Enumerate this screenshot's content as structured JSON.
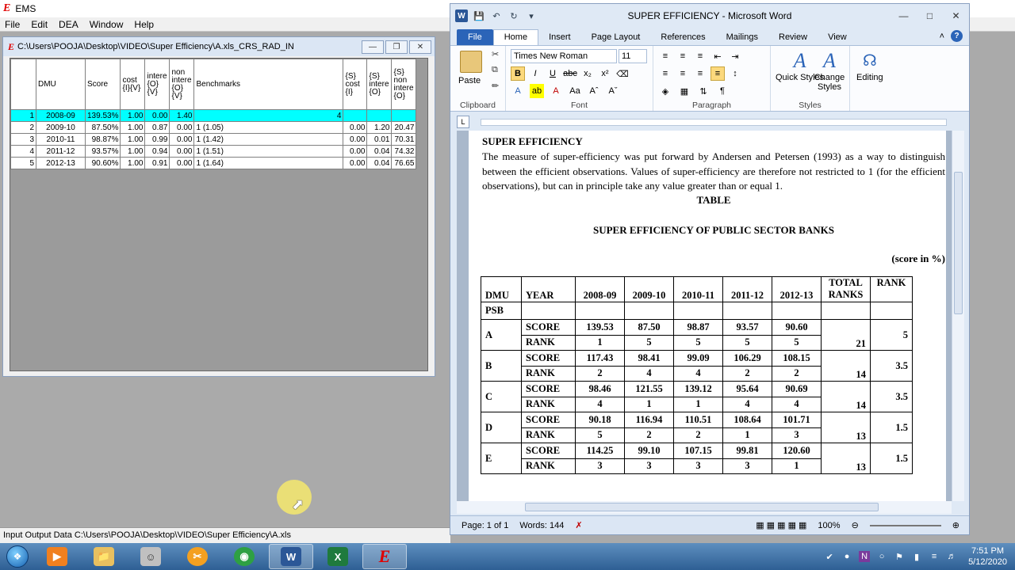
{
  "ems": {
    "title": "EMS",
    "logo": "E",
    "menu": [
      "File",
      "Edit",
      "DEA",
      "Window",
      "Help"
    ],
    "child_title": "C:\\Users\\POOJA\\Desktop\\VIDEO\\Super Efficiency\\A.xls_CRS_RAD_IN",
    "status": "Input Output Data C:\\Users\\POOJA\\Desktop\\VIDEO\\Super Efficiency\\A.xls",
    "grid": {
      "headers": [
        "DMU",
        "Score",
        "cost {I}{V}",
        "intere {O}{V}",
        "non intere {O}{V}",
        "Benchmarks",
        "{S} cost {I}",
        "{S} intere {O}",
        "{S} non intere {O}"
      ],
      "rows": [
        {
          "n": "1",
          "dmu": "2008-09",
          "score": "139.53%",
          "cost": "1.00",
          "intere": "0.00",
          "nonint": "1.40",
          "bench": "4",
          "s1": "",
          "s2": "",
          "s3": ""
        },
        {
          "n": "2",
          "dmu": "2009-10",
          "score": "87.50%",
          "cost": "1.00",
          "intere": "0.87",
          "nonint": "0.00",
          "bench": "1 (1.05)",
          "s1": "0.00",
          "s2": "1.20",
          "s3": "20.47"
        },
        {
          "n": "3",
          "dmu": "2010-11",
          "score": "98.87%",
          "cost": "1.00",
          "intere": "0.99",
          "nonint": "0.00",
          "bench": "1 (1.42)",
          "s1": "0.00",
          "s2": "0.01",
          "s3": "70.31"
        },
        {
          "n": "4",
          "dmu": "2011-12",
          "score": "93.57%",
          "cost": "1.00",
          "intere": "0.94",
          "nonint": "0.00",
          "bench": "1 (1.51)",
          "s1": "0.00",
          "s2": "0.04",
          "s3": "74.32"
        },
        {
          "n": "5",
          "dmu": "2012-13",
          "score": "90.60%",
          "cost": "1.00",
          "intere": "0.91",
          "nonint": "0.00",
          "bench": "1 (1.64)",
          "s1": "0.00",
          "s2": "0.04",
          "s3": "76.65"
        }
      ]
    }
  },
  "word": {
    "title": "SUPER EFFICIENCY  -  Microsoft Word",
    "tabs": [
      "File",
      "Home",
      "Insert",
      "Page Layout",
      "References",
      "Mailings",
      "Review",
      "View"
    ],
    "ribbon": {
      "paste": "Paste",
      "font_name": "Times New Roman",
      "font_size": "11",
      "quick_styles": "Quick Styles",
      "change_styles": "Change Styles",
      "editing": "Editing",
      "groups": [
        "Clipboard",
        "Font",
        "Paragraph",
        "Styles"
      ]
    },
    "doc": {
      "heading": "SUPER EFFICIENCY",
      "paragraph": "The measure of super-efficiency was put forward by Andersen and Petersen (1993) as a way to distinguish between the efficient observations. Values of super-efficiency are therefore not restricted to 1 (for the efficient observations), but can in principle take any value greater than or equal 1.",
      "table_caption": "TABLE",
      "table_title": "SUPER EFFICIENCY OF PUBLIC SECTOR BANKS",
      "unit_note": "(score in %)",
      "table": {
        "h_dmu": "DMU",
        "h_year": "YEAR",
        "years": [
          "2008-09",
          "2009-10",
          "2010-11",
          "2011-12",
          "2012-13"
        ],
        "h_total": "TOTAL RANKS",
        "h_rank": "RANK",
        "group_label": "PSB",
        "score_label": "SCORE",
        "rank_label": "RANK",
        "banks": [
          {
            "name": "A",
            "scores": [
              "139.53",
              "87.50",
              "98.87",
              "93.57",
              "90.60"
            ],
            "ranks": [
              "1",
              "5",
              "5",
              "5",
              "5"
            ],
            "total": "21",
            "rank": "5"
          },
          {
            "name": "B",
            "scores": [
              "117.43",
              "98.41",
              "99.09",
              "106.29",
              "108.15"
            ],
            "ranks": [
              "2",
              "4",
              "4",
              "2",
              "2"
            ],
            "total": "14",
            "rank": "3.5"
          },
          {
            "name": "C",
            "scores": [
              "98.46",
              "121.55",
              "139.12",
              "95.64",
              "90.69"
            ],
            "ranks": [
              "4",
              "1",
              "1",
              "4",
              "4"
            ],
            "total": "14",
            "rank": "3.5"
          },
          {
            "name": "D",
            "scores": [
              "90.18",
              "116.94",
              "110.51",
              "108.64",
              "101.71"
            ],
            "ranks": [
              "5",
              "2",
              "2",
              "1",
              "3"
            ],
            "total": "13",
            "rank": "1.5"
          },
          {
            "name": "E",
            "scores": [
              "114.25",
              "99.10",
              "107.15",
              "99.81",
              "120.60"
            ],
            "ranks": [
              "3",
              "3",
              "3",
              "3",
              "1"
            ],
            "total": "13",
            "rank": "1.5"
          }
        ]
      }
    },
    "status": {
      "page": "Page: 1 of 1",
      "words": "Words: 144",
      "zoom": "100%"
    }
  },
  "taskbar": {
    "time": "7:51 PM",
    "date": "5/12/2020"
  }
}
